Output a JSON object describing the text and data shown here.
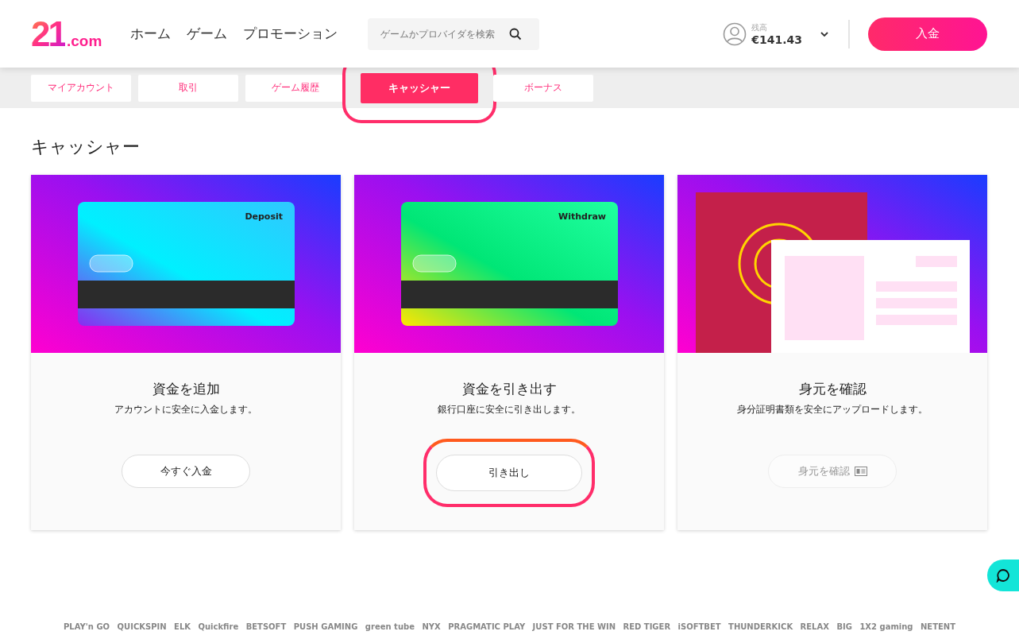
{
  "logo": {
    "mark": "21",
    "suffix": ".com"
  },
  "nav": [
    "ホーム",
    "ゲーム",
    "プロモーション"
  ],
  "search": {
    "placeholder": "ゲームかプロバイダを検索"
  },
  "account": {
    "balance_label": "残高",
    "balance": "€141.43"
  },
  "deposit_button": "入金",
  "tabs": [
    {
      "label": "マイアカウント",
      "selected": false,
      "highlighted": false
    },
    {
      "label": "取引",
      "selected": false,
      "highlighted": false
    },
    {
      "label": "ゲーム履歴",
      "selected": false,
      "highlighted": false
    },
    {
      "label": "キャッシャー",
      "selected": true,
      "highlighted": true
    },
    {
      "label": "ボーナス",
      "selected": false,
      "highlighted": false
    }
  ],
  "page_title": "キャッシャー",
  "cards": [
    {
      "kind": "deposit",
      "art_label": "Deposit",
      "title": "資金を追加",
      "description": "アカウントに安全に入金します。",
      "button": "今すぐ入金",
      "disabled": false,
      "highlighted": false
    },
    {
      "kind": "withdraw",
      "art_label": "Withdraw",
      "title": "資金を引き出す",
      "description": "銀行口座に安全に引き出します。",
      "button": "引き出し",
      "disabled": false,
      "highlighted": true
    },
    {
      "kind": "verify",
      "title": "身元を確認",
      "description": "身分証明書類を安全にアップロードします。",
      "button": "身元を確認",
      "disabled": true,
      "highlighted": false
    }
  ],
  "providers": [
    "PLAY'n GO",
    "QUICKSPIN",
    "ELK",
    "Quickfire",
    "BETSOFT",
    "PUSH GAMING",
    "green tube",
    "NYX",
    "PRAGMATIC PLAY",
    "JUST FOR THE WIN",
    "RED TIGER",
    "iSOFTBET",
    "THUNDERKICK",
    "RELAX",
    "BIG",
    "1X2 gaming",
    "NETENT"
  ]
}
